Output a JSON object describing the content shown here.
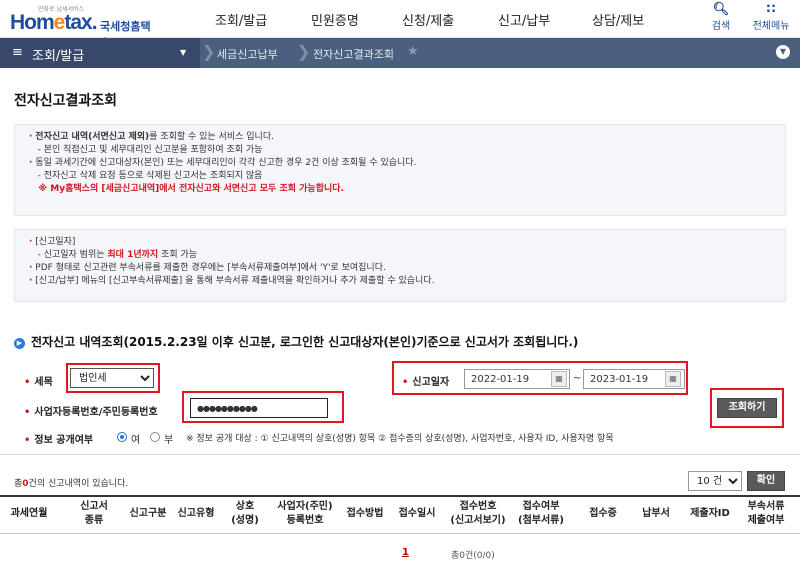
{
  "header": {
    "logo_slogan": "만화로 납세서비스",
    "logo_main": "Hom",
    "logo_e": "e",
    "logo_rest": "tax.",
    "logo_kr": "국세청홈택스",
    "gnb": [
      "조회/발급",
      "민원증명",
      "신청/제출",
      "신고/납부",
      "상담/제보"
    ],
    "search_label": "검색",
    "allmenu_label": "전체메뉴"
  },
  "navbar": {
    "menu_label": "조회/발급",
    "crumb1": "세금신고납부",
    "crumb2": "전자신고결과조회"
  },
  "page_title": "전자신고결과조회",
  "info1": {
    "line1_b": "전자신고 내역(서면신고 제외)",
    "line1_t": "를 조회할 수 있는 서비스 입니다.",
    "line2": "- 본인 직접신고 및 세무대리인 신고분을 포함하여 조회 가능",
    "line3": "동일 과세기간에 신고대상자(본인) 또는 세무대리인이 각각 신고한 경우 2건 이상 조회될 수 있습니다.",
    "line4": "- 전자신고 삭제 요청 등으로 삭제된 신고서는 조회되지 않음",
    "line5": "※ My홈택스의 [세금신고내역]에서 전자신고와 서면신고 모두 조회 가능합니다."
  },
  "info2": {
    "line1": "[신고일자]",
    "line2_a": "- 신고일자 범위는 ",
    "line2_b": "최대 1년까지",
    "line2_c": " 조회 가능",
    "line3": "PDF 형태로 신고관련 부속서류를 제출한 경우에는 [부속서류제출여부]에서 'Y'로 보여집니다.",
    "line4": "[신고/납부] 메뉴의 [신고부속서류제출] 을 통해 부속서류 제출내역을 확인하거나 추가 제출할 수 있습니다."
  },
  "section_title": "전자신고 내역조회(2015.2.23일 이후 신고분, 로그인한  신고대상자(본인)기준으로  신고서가 조회됩니다.)",
  "form": {
    "tax_label": "세목",
    "tax_value": "법인세",
    "date_label": "신고일자",
    "date_from": "2022-01-19",
    "date_to": "2023-01-19",
    "date_sep": "~",
    "regno_label": "사업자등록번호/주민등록번호",
    "regno_value": "●●●●●●●●●●",
    "search_button": "조회하기",
    "disclosure_label": "정보 공개여부",
    "yes": "여",
    "no": "부",
    "disclosure_note": "※ 정보 공개 대상 : ① 신고내역의 상호(성명) 항목 ② 접수증의 상호(성명), 사업자번호, 사용자 ID, 사용자명 항목"
  },
  "results": {
    "count_prefix": "총",
    "count": "0",
    "count_suffix": "건의 신고내역이 있습니다.",
    "page_size": "10 건",
    "confirm_button": "확인",
    "columns": [
      [
        "과세연월"
      ],
      [
        "신고서",
        "종류"
      ],
      [
        "신고구분"
      ],
      [
        "신고유형"
      ],
      [
        "상호",
        "(성명)"
      ],
      [
        "사업자(주민)",
        "등록번호"
      ],
      [
        "접수방법"
      ],
      [
        "접수일시"
      ],
      [
        "접수번호",
        "(신고서보기)"
      ],
      [
        "접수여부",
        "(첨부서류)"
      ],
      [
        "접수증"
      ],
      [
        "납부서"
      ],
      [
        "제출자ID"
      ],
      [
        "부속서류",
        "제출여부"
      ]
    ],
    "page_number": "1",
    "page_total": "총0건(0/0)"
  }
}
